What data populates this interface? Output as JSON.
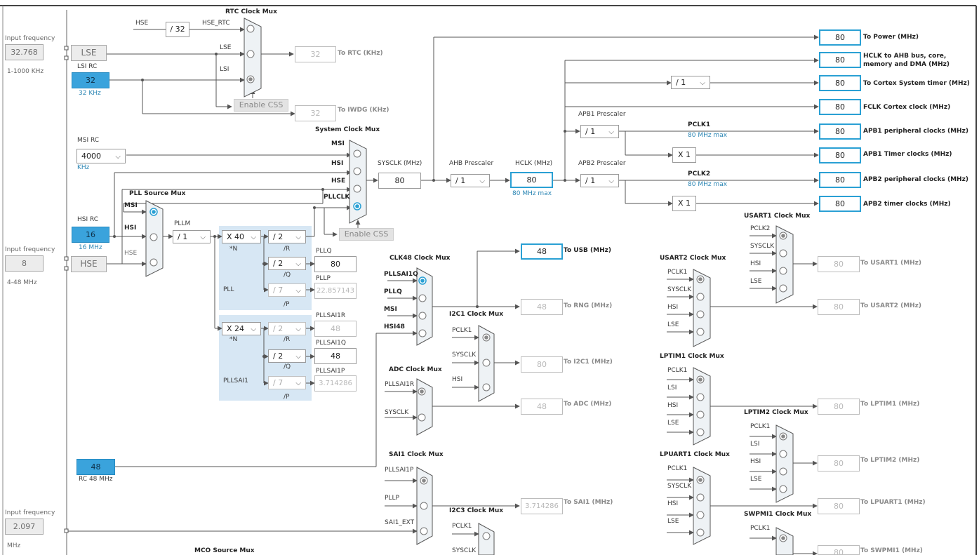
{
  "input_frequency": {
    "caption": "Input frequency",
    "lse_value": "32.768",
    "lse_range": "1-1000 KHz",
    "hse_value": "8",
    "hse_range": "4-48 MHz",
    "ext_value": "2.097",
    "ext_unit": "MHz"
  },
  "sources": {
    "lse": "LSE",
    "lsi_title": "LSI RC",
    "lsi_value": "32",
    "lsi_unit": "32 KHz",
    "msi_title": "MSI RC",
    "msi_value": "4000",
    "msi_unit": "KHz",
    "hsi_title": "HSI RC",
    "hsi_value": "16",
    "hsi_unit": "16 MHz",
    "hse": "HSE",
    "rc48_value": "48",
    "rc48_unit": "RC 48 MHz"
  },
  "rtc": {
    "title": "RTC Clock Mux",
    "hse": "HSE",
    "div": "/ 32",
    "hse_rtc": "HSE_RTC",
    "lse": "LSE",
    "lsi": "LSI",
    "enable_css": "Enable CSS",
    "rtc_value": "32",
    "rtc_label": "To RTC (KHz)",
    "iwdg_value": "32",
    "iwdg_label": "To IWDG (KHz)"
  },
  "sysmux": {
    "title": "System Clock Mux",
    "msi": "MSI",
    "hsi": "HSI",
    "hse": "HSE",
    "pllclk": "PLLCLK",
    "enable_css": "Enable CSS",
    "sysclk_label": "SYSCLK (MHz)",
    "sysclk_value": "80"
  },
  "pll": {
    "source_title": "PLL Source Mux",
    "msi": "MSI",
    "hsi": "HSI",
    "hse": "HSE",
    "pllm_label": "PLLM",
    "pllm": "/ 1",
    "n": "X 40",
    "n_label": "*N",
    "r": "/ 2",
    "r_label": "/R",
    "q": "/ 2",
    "q_label": "/Q",
    "p": "/ 7",
    "p_label": "/P",
    "pllq_label": "PLLQ",
    "pllq_value": "80",
    "pllp_label": "PLLP",
    "pllp_value": "22.857143",
    "pll_label": "PLL"
  },
  "pllsai1": {
    "n": "X 24",
    "n_label": "*N",
    "r": "/ 2",
    "r_label": "/R",
    "q": "/ 2",
    "q_label": "/Q",
    "p": "/ 7",
    "p_label": "/P",
    "r_out_label": "PLLSAI1R",
    "r_out_value": "48",
    "q_out_label": "PLLSAI1Q",
    "q_out_value": "48",
    "p_out_label": "PLLSAI1P",
    "p_out_value": "3.714286",
    "label": "PLLSAI1"
  },
  "ahb": {
    "prescaler_label": "AHB Prescaler",
    "prescaler": "/ 1",
    "hclk_label": "HCLK (MHz)",
    "hclk_value": "80",
    "hclk_max": "80 MHz max"
  },
  "apb1": {
    "prescaler_label": "APB1 Prescaler",
    "prescaler": "/ 1",
    "pclk_label": "PCLK1",
    "pclk_max": "80 MHz max",
    "timer_mult": "X 1"
  },
  "apb2": {
    "prescaler_label": "APB2 Prescaler",
    "prescaler": "/ 1",
    "pclk_label": "PCLK2",
    "pclk_max": "80 MHz max",
    "timer_mult": "X 1"
  },
  "cortex_div": "/ 1",
  "outputs": [
    {
      "value": "80",
      "label": "To Power (MHz)"
    },
    {
      "value": "80",
      "label": "HCLK to AHB bus, core,"
    },
    {
      "value": "80",
      "label": "To Cortex System timer (MHz)"
    },
    {
      "value": "80",
      "label": "FCLK Cortex clock (MHz)"
    },
    {
      "value": "80",
      "label": "APB1 peripheral clocks (MHz)"
    },
    {
      "value": "80",
      "label": "APB1 Timer clocks (MHz)"
    },
    {
      "value": "80",
      "label": "APB2 peripheral clocks (MHz)"
    },
    {
      "value": "80",
      "label": "APB2 timer clocks (MHz)"
    }
  ],
  "hclk_label_line2": "memory and DMA (MHz)",
  "clk48": {
    "title": "CLK48 Clock Mux",
    "in1": "PLLSAI1Q",
    "in2": "PLLQ",
    "in3": "MSI",
    "in4": "HSI48",
    "usb_value": "48",
    "usb_label": "To USB (MHz)",
    "rng_value": "48",
    "rng_label": "To RNG (MHz)"
  },
  "i2c1": {
    "title": "I2C1 Clock Mux",
    "in1": "PCLK1",
    "in2": "SYSCLK",
    "in3": "HSI",
    "value": "80",
    "label": "To I2C1 (MHz)"
  },
  "adc": {
    "title": "ADC Clock Mux",
    "in1": "PLLSAI1R",
    "in2": "SYSCLK",
    "value": "48",
    "label": "To ADC (MHz)"
  },
  "sai1": {
    "title": "SAI1 Clock Mux",
    "in1": "PLLSAI1P",
    "in2": "PLLP",
    "in3": "SAI1_EXT",
    "value": "3.714286",
    "label": "To SAI1 (MHz)"
  },
  "i2c3": {
    "title": "I2C3 Clock Mux",
    "in1": "PCLK1",
    "in2": "SYSCLK"
  },
  "mco_title": "MCO Source Mux",
  "usart1": {
    "title": "USART1 Clock Mux",
    "in1": "PCLK2",
    "in2": "SYSCLK",
    "in3": "HSI",
    "in4": "LSE",
    "value": "80",
    "label": "To USART1 (MHz)"
  },
  "usart2": {
    "title": "USART2 Clock Mux",
    "in1": "PCLK1",
    "in2": "SYSCLK",
    "in3": "HSI",
    "in4": "LSE",
    "value": "80",
    "label": "To USART2 (MHz)"
  },
  "lptim1": {
    "title": "LPTIM1 Clock Mux",
    "in1": "PCLK1",
    "in2": "LSI",
    "in3": "HSI",
    "in4": "LSE",
    "value": "80",
    "label": "To LPTIM1 (MHz)"
  },
  "lptim2": {
    "title": "LPTIM2 Clock Mux",
    "in1": "PCLK1",
    "in2": "LSI",
    "in3": "HSI",
    "in4": "LSE",
    "value": "80",
    "label": "To LPTIM2 (MHz)"
  },
  "lpuart1": {
    "title": "LPUART1 Clock Mux",
    "in1": "PCLK1",
    "in2": "SYSCLK",
    "in3": "HSI",
    "in4": "LSE",
    "value": "80",
    "label": "To LPUART1 (MHz)"
  },
  "swpmi1": {
    "title": "SWPMI1 Clock Mux",
    "in1": "PCLK1",
    "value": "80",
    "label": "To SWPMI1 (MHz)"
  },
  "icons": {
    "dropdown": "chevron-down-icon",
    "radio": "radio-icon"
  },
  "colors": {
    "source_fill": "#3aa3dc",
    "highlight_border": "#2aa0d4",
    "pll_region": "#d7e7f4",
    "wire": "#555555"
  }
}
